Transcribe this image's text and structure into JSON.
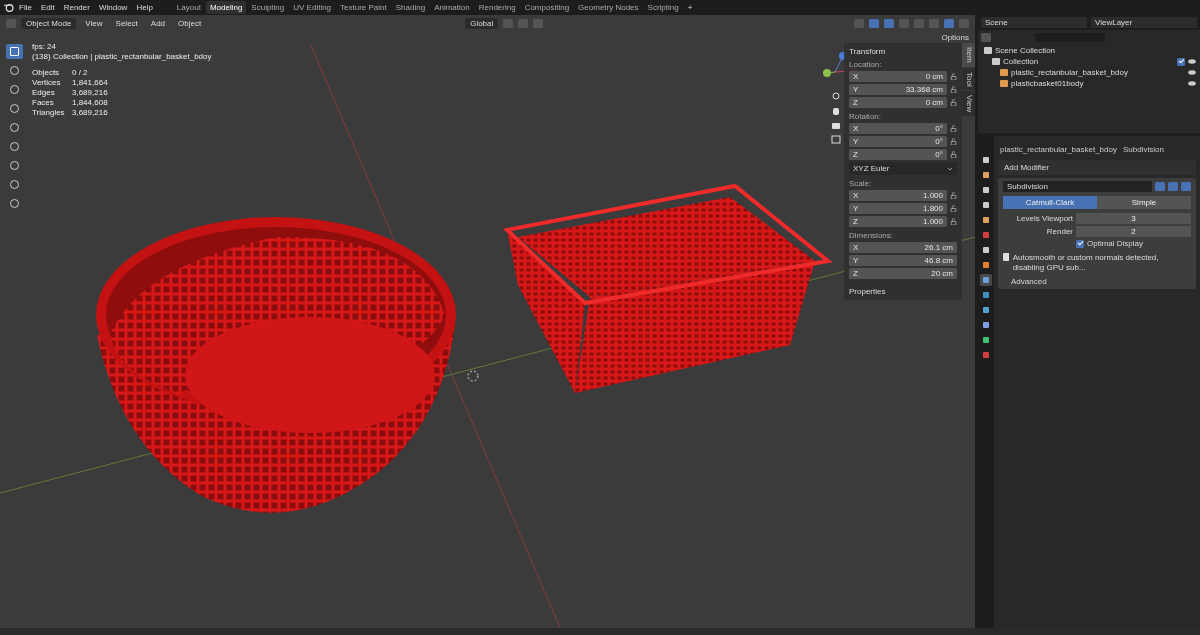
{
  "menu_bar": {
    "menus": [
      "File",
      "Edit",
      "Render",
      "Window",
      "Help"
    ],
    "workspaces": [
      {
        "label": "Layout",
        "selected": false
      },
      {
        "label": "Modeling",
        "selected": true
      },
      {
        "label": "Sculpting",
        "selected": false
      },
      {
        "label": "UV Editing",
        "selected": false
      },
      {
        "label": "Texture Paint",
        "selected": false
      },
      {
        "label": "Shading",
        "selected": false
      },
      {
        "label": "Animation",
        "selected": false
      },
      {
        "label": "Rendering",
        "selected": false
      },
      {
        "label": "Compositing",
        "selected": false
      },
      {
        "label": "Geometry Nodes",
        "selected": false
      },
      {
        "label": "Scripting",
        "selected": false
      }
    ],
    "add": "+"
  },
  "viewport_header": {
    "mode": "Object Mode",
    "menus": [
      "View",
      "Select",
      "Add",
      "Object"
    ],
    "orientation": "Global",
    "options": "Options"
  },
  "overlay": {
    "fps": "fps: 24",
    "context": "(138) Collection | plastic_rectanbular_basket_bdoy",
    "stats": [
      {
        "label": "Objects",
        "value": "0 / 2"
      },
      {
        "label": "Vertices",
        "value": "1,841,664"
      },
      {
        "label": "Edges",
        "value": "3,689,216"
      },
      {
        "label": "Faces",
        "value": "1,844,608"
      },
      {
        "label": "Triangles",
        "value": "3,689,216"
      }
    ]
  },
  "sidebar_tabs": [
    {
      "label": "Item",
      "selected": true
    },
    {
      "label": "Tool",
      "selected": false
    },
    {
      "label": "View",
      "selected": false
    }
  ],
  "transform": {
    "title": "Transform",
    "groups": [
      {
        "kind": "locked",
        "label": "Location:",
        "fields": [
          {
            "axis": "X",
            "value": "0 cm"
          },
          {
            "axis": "Y",
            "value": "33.368 cm"
          },
          {
            "axis": "Z",
            "value": "0 cm"
          }
        ]
      },
      {
        "kind": "locked",
        "label": "Rotation:",
        "fields": [
          {
            "axis": "X",
            "value": "0°"
          },
          {
            "axis": "Y",
            "value": "0°"
          },
          {
            "axis": "Z",
            "value": "0°"
          }
        ]
      },
      {
        "kind": "dropdown",
        "value": "XYZ Euler"
      },
      {
        "kind": "locked",
        "label": "Scale:",
        "fields": [
          {
            "axis": "X",
            "value": "1.000"
          },
          {
            "axis": "Y",
            "value": "1.800"
          },
          {
            "axis": "Z",
            "value": "1.000"
          }
        ]
      },
      {
        "kind": "vector",
        "label": "Dimensions:",
        "fields": [
          {
            "axis": "X",
            "value": "26.1 cm"
          },
          {
            "axis": "Y",
            "value": "46.8 cm"
          },
          {
            "axis": "Z",
            "value": "20 cm"
          }
        ]
      }
    ],
    "properties": "Properties"
  },
  "outliner": {
    "scene": "Scene",
    "view_layer": "ViewLayer",
    "tree": [
      {
        "label": "Scene Collection",
        "children": [
          {
            "label": "Collection",
            "checked": true,
            "children": [
              {
                "label": "plastic_rectanbular_basket_bdoy"
              },
              {
                "label": "plasticbasket01body"
              }
            ]
          }
        ]
      }
    ]
  },
  "properties": {
    "tabs": [
      {
        "selected": false
      },
      {
        "selected": false
      },
      {
        "selected": false
      },
      {
        "selected": false
      },
      {
        "selected": false
      },
      {
        "selected": false
      },
      {
        "selected": false
      },
      {
        "selected": false
      },
      {
        "selected": true
      },
      {
        "selected": false
      },
      {
        "selected": false
      },
      {
        "selected": false
      },
      {
        "selected": false
      },
      {
        "selected": false
      }
    ],
    "breadcrumb": {
      "object": "plastic_rectanbular_basket_bdoy",
      "modifier": "Subdivision"
    },
    "add_modifier": "Add Modifier",
    "modifier": {
      "name": "Subdivision",
      "types": [
        {
          "label": "Catmull-Clark",
          "selected": true
        },
        {
          "label": "Simple",
          "selected": false
        }
      ],
      "fields": [
        {
          "label": "Levels Viewport",
          "value": "3"
        },
        {
          "label": "Render",
          "value": "2"
        }
      ],
      "optimal_display": {
        "label": "Optimal Display",
        "checked": true
      },
      "warning": "Autosmooth or custom normals detected, disabling GPU sub...",
      "advanced": "Advanced"
    }
  }
}
